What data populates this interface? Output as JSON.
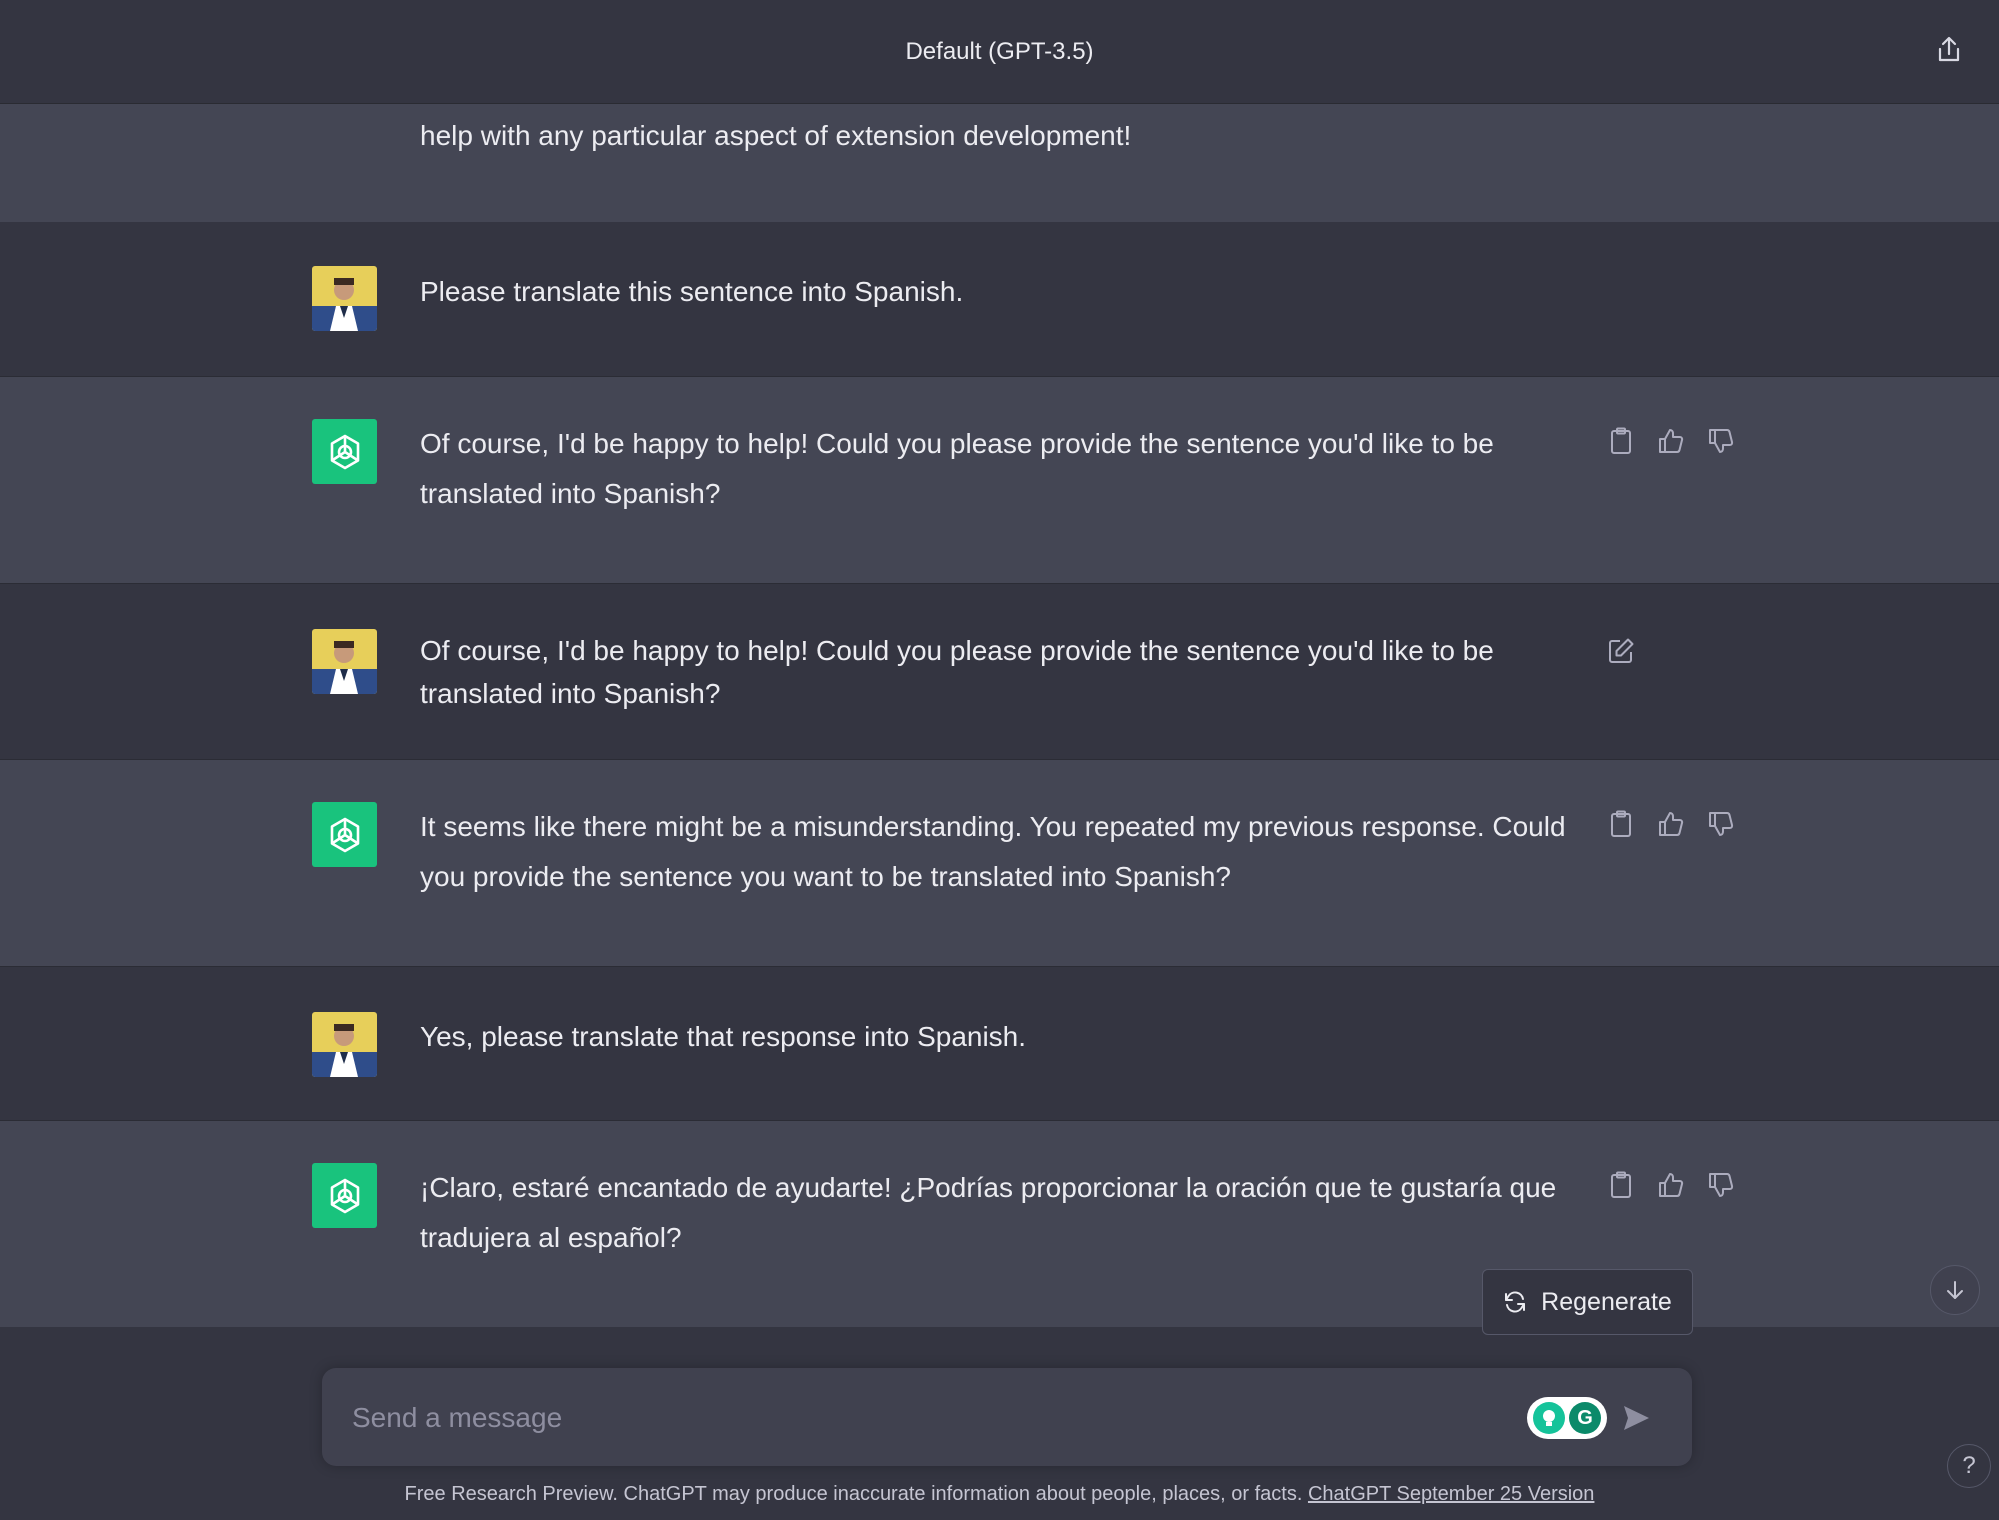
{
  "header": {
    "title": "Default (GPT-3.5)"
  },
  "conversation": {
    "partial_message": "help with any particular aspect of extension development!",
    "messages": [
      {
        "role": "user",
        "text": "Please translate this sentence into Spanish."
      },
      {
        "role": "assistant",
        "text": "Of course, I'd be happy to help! Could you please provide the sentence you'd like to be translated into Spanish?"
      },
      {
        "role": "user",
        "text": "Of course, I'd be happy to help! Could you please provide the sentence you'd like to be translated into Spanish?"
      },
      {
        "role": "assistant",
        "text": "It seems like there might be a misunderstanding. You repeated my previous response. Could you provide the sentence you want to be translated into Spanish?"
      },
      {
        "role": "user",
        "text": "Yes, please translate that response into Spanish."
      },
      {
        "role": "assistant",
        "text": "¡Claro, estaré encantado de ayudarte! ¿Podrías proporcionar la oración que te gustaría que tradujera al español?"
      }
    ]
  },
  "regenerate": {
    "label": "Regenerate"
  },
  "composer": {
    "placeholder": "Send a message"
  },
  "footer": {
    "text": "Free Research Preview. ChatGPT may produce inaccurate information about people, places, or facts. ",
    "link": "ChatGPT September 25 Version"
  },
  "help": {
    "label": "?"
  },
  "colors": {
    "background": "#343541",
    "assistant_row": "#444654",
    "accent": "#19c37d"
  },
  "icons": {
    "share": "share-icon",
    "copy": "clipboard-icon",
    "thumbs_up": "thumbs-up-icon",
    "thumbs_down": "thumbs-down-icon",
    "edit": "edit-icon",
    "regenerate": "refresh-icon",
    "scroll": "arrow-down-icon",
    "send": "send-icon"
  }
}
